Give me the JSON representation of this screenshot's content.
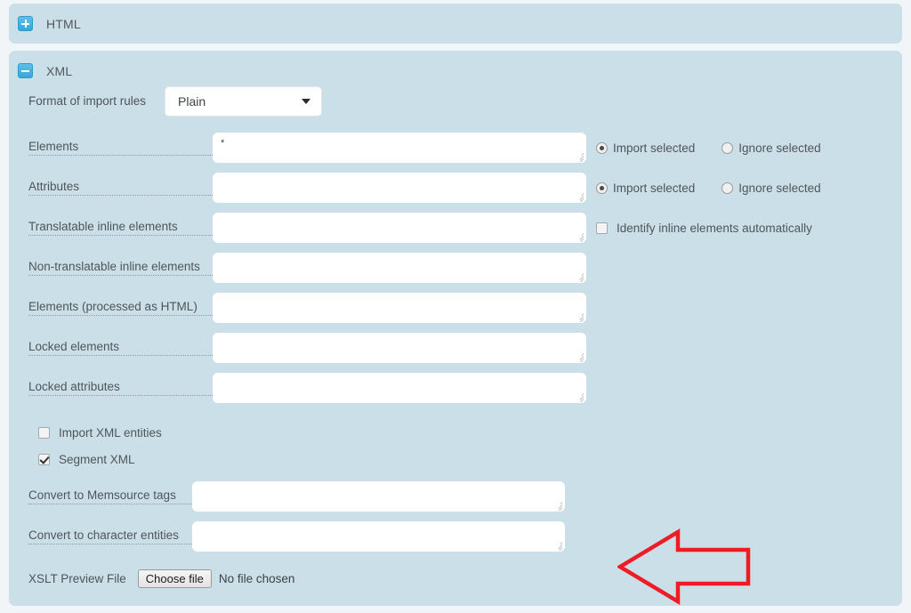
{
  "page": {
    "background_color": "#f2f5f7",
    "panel_color": "#cadfe8",
    "accent_color": "#33a8dd",
    "annotation_color": "#ee1c25"
  },
  "panels": [
    {
      "id": "html",
      "title": "HTML",
      "toggle_icon": "plus-icon",
      "expanded": false
    },
    {
      "id": "xml",
      "title": "XML",
      "toggle_icon": "minus-icon",
      "expanded": true
    }
  ],
  "xml": {
    "format_of_import_rules": {
      "label": "Format of import rules",
      "value": "Plain",
      "caret_icon": "chevron-down-icon"
    },
    "fields": [
      {
        "label": "Elements",
        "value": "*",
        "options": [
          "Import selected",
          "Ignore selected"
        ],
        "selected_option": "Import selected",
        "control": "radio"
      },
      {
        "label": "Attributes",
        "value": "",
        "options": [
          "Import selected",
          "Ignore selected"
        ],
        "selected_option": "Import selected",
        "control": "radio"
      },
      {
        "label": "Translatable inline elements",
        "value": "",
        "checkbox_label": "Identify inline elements automatically",
        "checkbox_checked": false,
        "control": "checkbox"
      },
      {
        "label": "Non-translatable inline elements",
        "value": "",
        "control": "none"
      },
      {
        "label": "Elements (processed as HTML)",
        "value": "",
        "control": "none"
      },
      {
        "label": "Locked elements",
        "value": "",
        "control": "none"
      },
      {
        "label": "Locked attributes",
        "value": "",
        "control": "none"
      }
    ],
    "checkboxes": [
      {
        "label": "Import XML entities",
        "checked": false
      },
      {
        "label": "Segment XML",
        "checked": true
      }
    ],
    "convert_fields": [
      {
        "label": "Convert to Memsource tags",
        "value": ""
      },
      {
        "label": "Convert to character entities",
        "value": ""
      }
    ],
    "xslt": {
      "label": "XSLT Preview File",
      "button_label": "Choose file",
      "status": "No file chosen"
    }
  },
  "annotation": {
    "name": "left-pointing-arrow",
    "color": "#ee1c25",
    "direction": "left"
  }
}
